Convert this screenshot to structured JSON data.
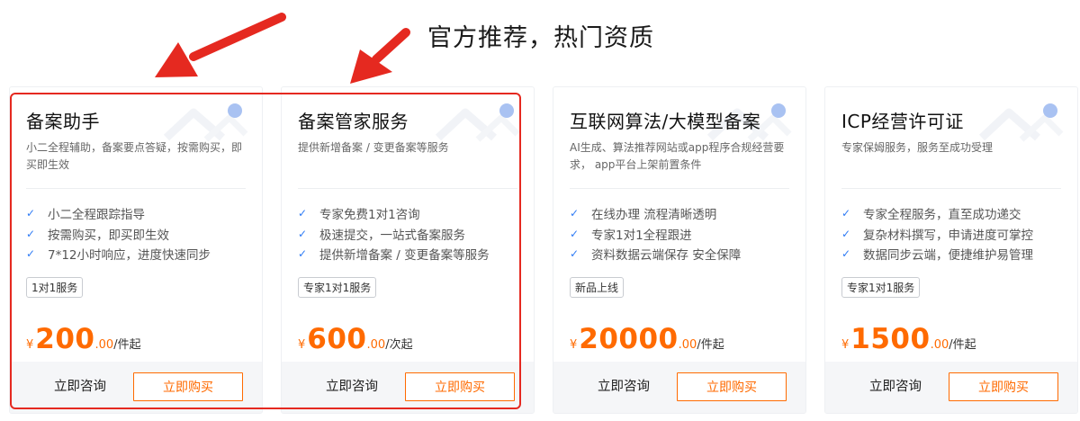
{
  "headline": "官方推荐，热门资质",
  "colors": {
    "accent": "#ff6a00",
    "check": "#2f7bf5",
    "highlight": "#e52920"
  },
  "cards": [
    {
      "title": "备案助手",
      "desc": "小二全程辅助，备案要点答疑，按需购买，即买即生效",
      "features": [
        "小二全程跟踪指导",
        "按需购买，即买即生效",
        "7*12小时响应，进度快速同步"
      ],
      "tag": "1对1服务",
      "price": {
        "currency": "¥",
        "integer": "200",
        "decimal": ".00",
        "unit": "/件起"
      },
      "consult": "立即咨询",
      "buy": "立即购买"
    },
    {
      "title": "备案管家服务",
      "desc": "提供新增备案 / 变更备案等服务",
      "features": [
        "专家免费1对1咨询",
        "极速提交，一站式备案服务",
        "提供新增备案 / 变更备案等服务"
      ],
      "tag": "专家1对1服务",
      "price": {
        "currency": "¥",
        "integer": "600",
        "decimal": ".00",
        "unit": "/次起"
      },
      "consult": "立即咨询",
      "buy": "立即购买"
    },
    {
      "title": "互联网算法/大模型备案",
      "desc": "AI生成、算法推荐网站或app程序合规经营要求， app平台上架前置条件",
      "features": [
        "在线办理 流程清晰透明",
        "专家1对1全程跟进",
        "资料数据云端保存 安全保障"
      ],
      "tag": "新品上线",
      "price": {
        "currency": "¥",
        "integer": "20000",
        "decimal": ".00",
        "unit": "/件起"
      },
      "consult": "立即咨询",
      "buy": "立即购买"
    },
    {
      "title": "ICP经营许可证",
      "desc": "专家保姆服务，服务至成功受理",
      "features": [
        "专家全程服务，直至成功递交",
        "复杂材料撰写，申请进度可掌控",
        "数据同步云端，便捷维护易管理"
      ],
      "tag": "专家1对1服务",
      "price": {
        "currency": "¥",
        "integer": "1500",
        "decimal": ".00",
        "unit": "/件起"
      },
      "consult": "立即咨询",
      "buy": "立即购买"
    }
  ]
}
